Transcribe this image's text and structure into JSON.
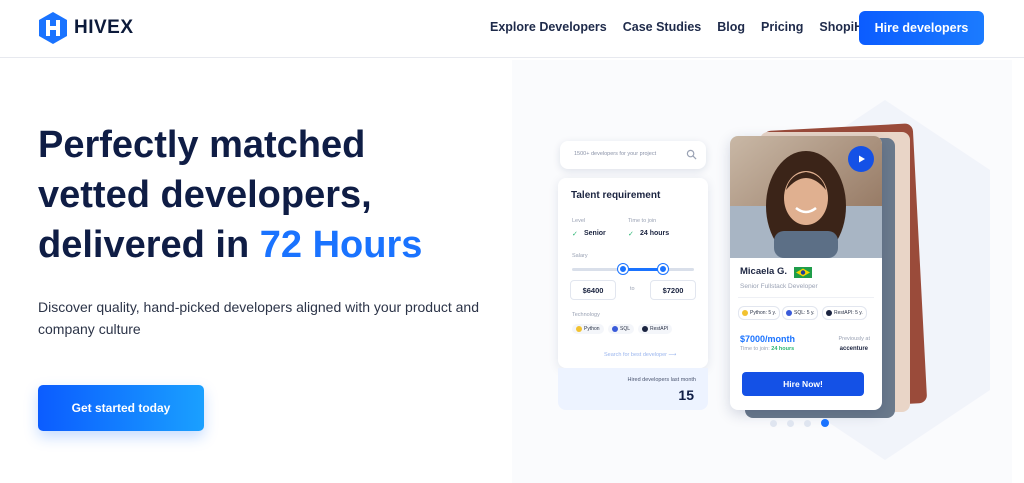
{
  "header": {
    "logo_text": "HIVEX",
    "nav": [
      "Explore Developers",
      "Case Studies",
      "Blog",
      "Pricing",
      "ShopiHive"
    ],
    "hire_button": "Hire developers"
  },
  "hero": {
    "title_line1": "Perfectly matched",
    "title_line2": "vetted developers,",
    "title_line3_prefix": "delivered in ",
    "title_line3_accent": "72 Hours",
    "subtitle": "Discover quality, hand-picked developers aligned with your product and company culture",
    "cta": "Get started today"
  },
  "search_card": {
    "placeholder": "1500+ developers for your project"
  },
  "talent_card": {
    "title": "Talent requirement",
    "level_label": "Level",
    "level_value": "Senior",
    "time_label": "Time to join",
    "time_value": "24 hours",
    "salary_label": "Salary",
    "salary_min": "$6400",
    "salary_to": "to",
    "salary_max": "$7200",
    "technology_label": "Technology",
    "technologies": [
      "Python",
      "SQL",
      "RestAPI"
    ],
    "search_link": "Search for best developer  ⟶",
    "hired_label": "Hired developers last month",
    "hired_count": "15"
  },
  "profile": {
    "name": "Micaela G.",
    "title": "Senior Fullstack Developer",
    "skills": [
      "Python: 5 y.",
      "SQL: 5 y.",
      "RestAPI: 5 y."
    ],
    "price": "$7000/month",
    "join_prefix": "Time to join: ",
    "join_value": "24 hours",
    "previously_label": "Previously at",
    "company": "accenture",
    "hire_button": "Hire Now!"
  },
  "colors": {
    "accent": "#1a73ff",
    "dark": "#0f1d45",
    "button": "#1451e6"
  }
}
